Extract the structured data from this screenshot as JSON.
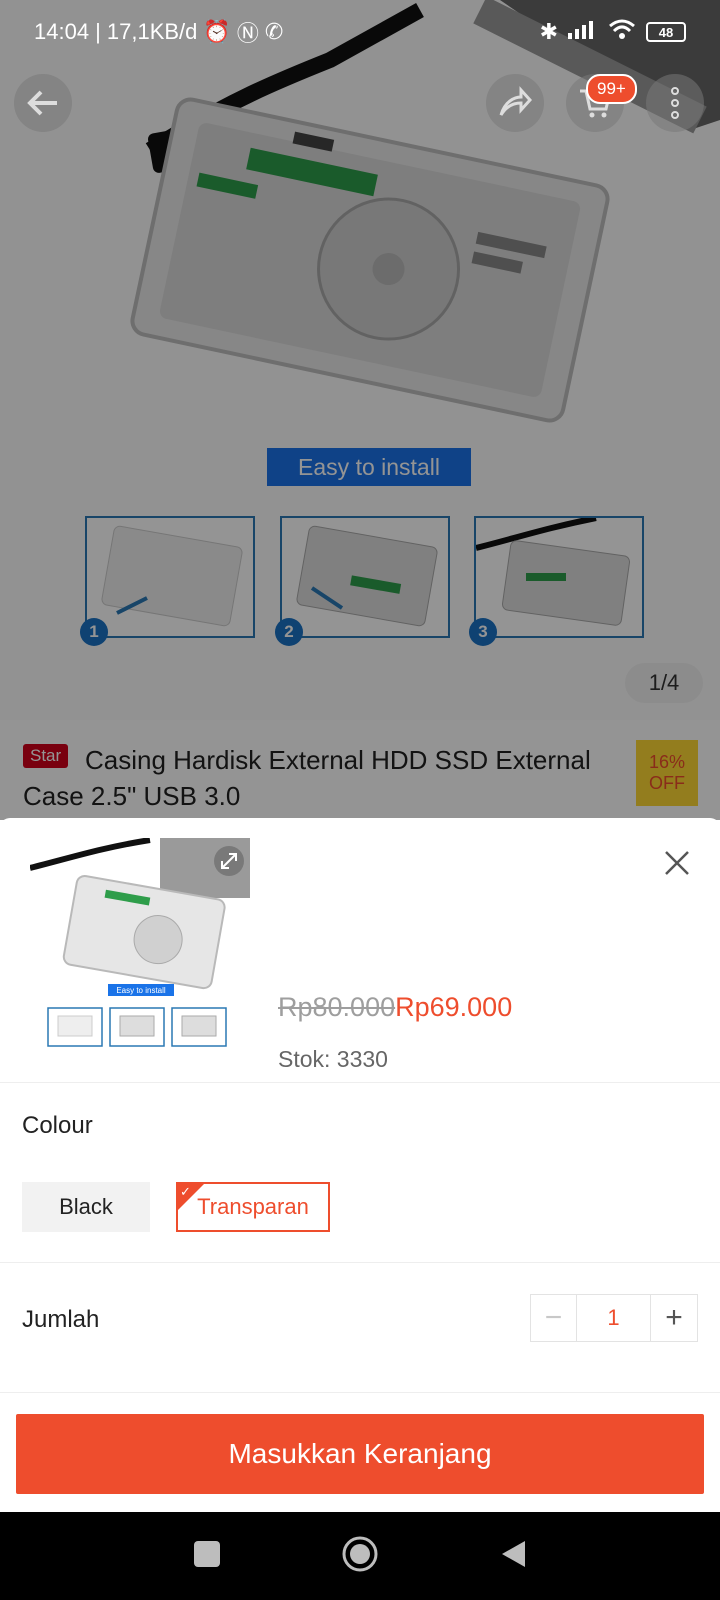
{
  "status_bar": {
    "time": "14:04",
    "speed": "| 17,1KB/d",
    "battery": "48"
  },
  "gallery": {
    "pager": "1/4",
    "install_banner": "Easy to install",
    "steps": [
      "1",
      "2",
      "3"
    ]
  },
  "header": {
    "cart_badge": "99+",
    "icons": [
      "back-arrow-icon",
      "share-icon",
      "cart-icon",
      "more-icon"
    ]
  },
  "product": {
    "tag": "Star",
    "title": "Casing Hardisk External HDD SSD External Case 2.5\" USB 3.0",
    "discount_pct": "16%",
    "discount_label": "OFF"
  },
  "sheet": {
    "price_original": "Rp80.000",
    "price_current": "Rp69.000",
    "stock": "Stok: 3330",
    "thumb_banner": "Easy to install",
    "colour_label": "Colour",
    "colour_options": [
      "Black",
      "Transparan"
    ],
    "colour_selected": "Transparan",
    "quantity_label": "Jumlah",
    "quantity_value": "1",
    "quantity_minus": "−",
    "quantity_plus": "+",
    "add_to_cart": "Masukkan Keranjang"
  },
  "colors": {
    "accent": "#ee4d2d",
    "tag_red": "#d0011b",
    "discount_yellow": "#fdd835"
  }
}
